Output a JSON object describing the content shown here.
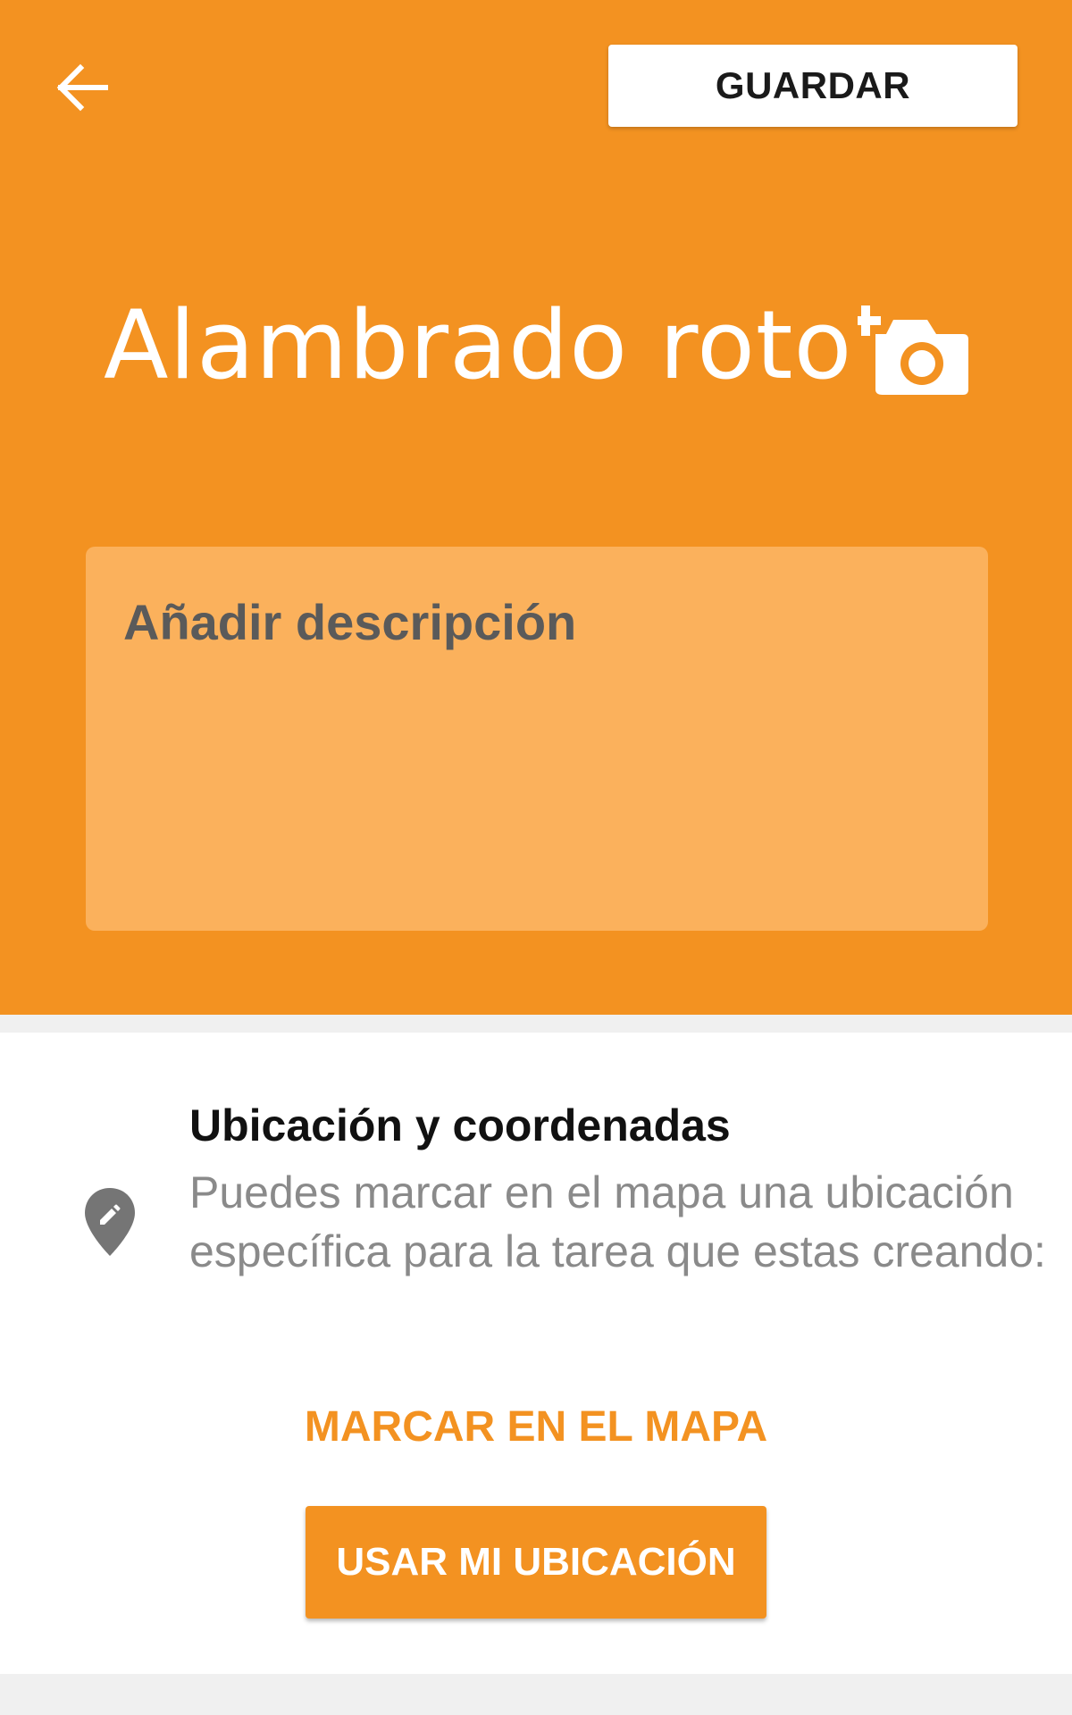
{
  "toolbar": {
    "back_icon": "arrow-back-icon",
    "save_label": "GUARDAR"
  },
  "task": {
    "title": "Alambrado roto",
    "photo_icon": "add-photo-icon",
    "description_placeholder": "Añadir descripción"
  },
  "location": {
    "icon": "edit-location-icon",
    "title": "Ubicación y coordenadas",
    "description": "Puedes marcar en el mapa una ubicación específica para la tarea que estas creando:",
    "map_link_label": "MARCAR EN EL MAPA",
    "use_location_label": "USAR MI UBICACIÓN"
  },
  "colors": {
    "accent": "#f39221",
    "description_box": "#fbb15c",
    "background": "#f0f0f0",
    "card": "#ffffff"
  }
}
